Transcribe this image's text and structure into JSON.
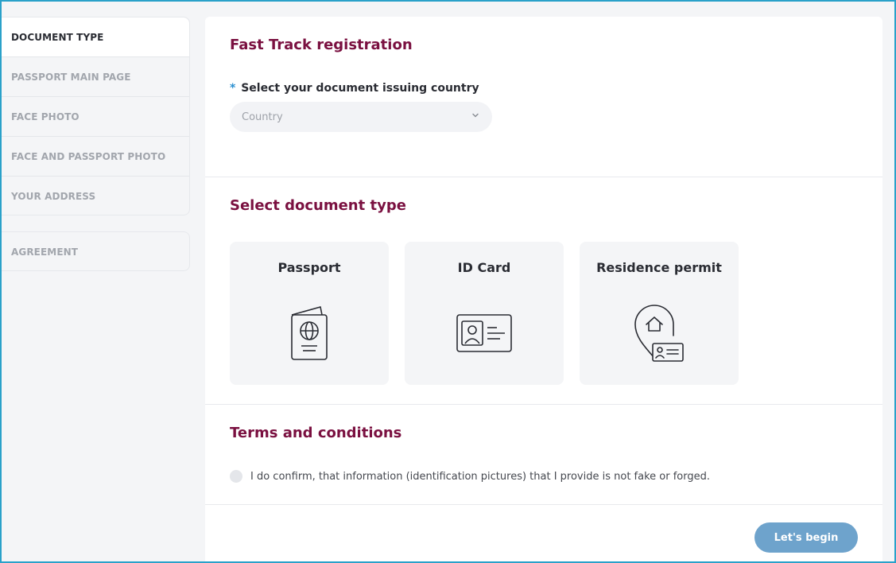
{
  "sidebar": {
    "items": [
      {
        "label": "DOCUMENT TYPE"
      },
      {
        "label": "PASSPORT MAIN PAGE"
      },
      {
        "label": "FACE PHOTO"
      },
      {
        "label": "FACE AND PASSPORT PHOTO"
      },
      {
        "label": "YOUR ADDRESS"
      }
    ],
    "agreement": {
      "label": "AGREEMENT"
    }
  },
  "registration": {
    "title": "Fast Track registration",
    "required_mark": "*",
    "country_label": "Select your document issuing country",
    "country_placeholder": "Country"
  },
  "document_type": {
    "title": "Select document type",
    "options": [
      {
        "label": "Passport",
        "icon": "passport-icon"
      },
      {
        "label": "ID Card",
        "icon": "id-card-icon"
      },
      {
        "label": "Residence permit",
        "icon": "residence-permit-icon"
      }
    ]
  },
  "terms": {
    "title": "Terms and conditions",
    "confirm_text": "I do confirm, that information (identification pictures) that I provide is not fake or forged."
  },
  "actions": {
    "begin_label": "Let's begin"
  },
  "colors": {
    "accent_title": "#7a1040",
    "button": "#6ea3cc",
    "frame": "#2aa1c9",
    "required": "#2a8fd0"
  }
}
